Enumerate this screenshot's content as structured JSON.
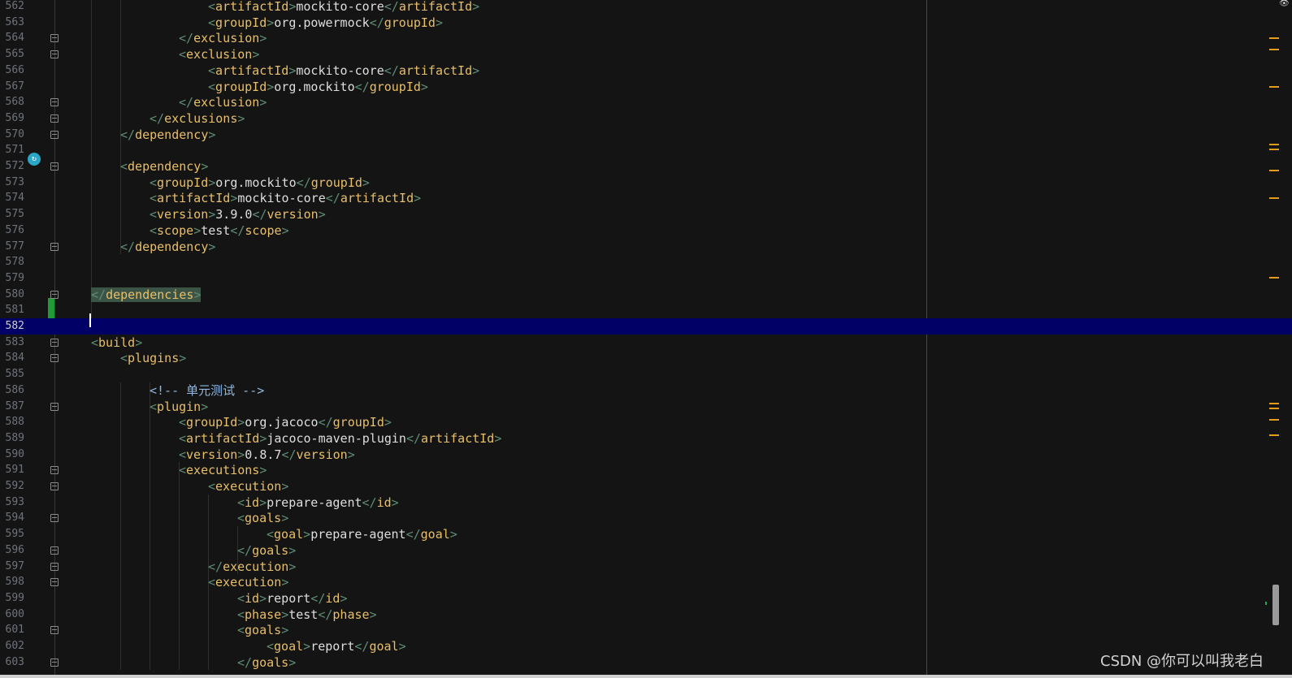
{
  "editor": {
    "lines": [
      {
        "n": "562",
        "fold": false,
        "indent": 16,
        "parts": [
          [
            "b",
            "<"
          ],
          [
            "t",
            "artifactId"
          ],
          [
            "b",
            ">"
          ],
          [
            "x",
            "mockito-core"
          ],
          [
            "b",
            "</"
          ],
          [
            "t",
            "artifactId"
          ],
          [
            "b",
            ">"
          ]
        ]
      },
      {
        "n": "563",
        "fold": false,
        "indent": 16,
        "parts": [
          [
            "b",
            "<"
          ],
          [
            "t",
            "groupId"
          ],
          [
            "b",
            ">"
          ],
          [
            "x",
            "org.powermock"
          ],
          [
            "b",
            "</"
          ],
          [
            "t",
            "groupId"
          ],
          [
            "b",
            ">"
          ]
        ]
      },
      {
        "n": "564",
        "fold": true,
        "indent": 12,
        "parts": [
          [
            "b",
            "</"
          ],
          [
            "t",
            "exclusion"
          ],
          [
            "b",
            ">"
          ]
        ]
      },
      {
        "n": "565",
        "fold": true,
        "indent": 12,
        "parts": [
          [
            "b",
            "<"
          ],
          [
            "t",
            "exclusion"
          ],
          [
            "b",
            ">"
          ]
        ]
      },
      {
        "n": "566",
        "fold": false,
        "indent": 16,
        "parts": [
          [
            "b",
            "<"
          ],
          [
            "t",
            "artifactId"
          ],
          [
            "b",
            ">"
          ],
          [
            "x",
            "mockito-core"
          ],
          [
            "b",
            "</"
          ],
          [
            "t",
            "artifactId"
          ],
          [
            "b",
            ">"
          ]
        ]
      },
      {
        "n": "567",
        "fold": false,
        "indent": 16,
        "parts": [
          [
            "b",
            "<"
          ],
          [
            "t",
            "groupId"
          ],
          [
            "b",
            ">"
          ],
          [
            "x",
            "org.mockito"
          ],
          [
            "b",
            "</"
          ],
          [
            "t",
            "groupId"
          ],
          [
            "b",
            ">"
          ]
        ]
      },
      {
        "n": "568",
        "fold": true,
        "indent": 12,
        "parts": [
          [
            "b",
            "</"
          ],
          [
            "t",
            "exclusion"
          ],
          [
            "b",
            ">"
          ]
        ]
      },
      {
        "n": "569",
        "fold": true,
        "indent": 8,
        "parts": [
          [
            "b",
            "</"
          ],
          [
            "t",
            "exclusions"
          ],
          [
            "b",
            ">"
          ]
        ]
      },
      {
        "n": "570",
        "fold": true,
        "indent": 4,
        "parts": [
          [
            "b",
            "</"
          ],
          [
            "t",
            "dependency"
          ],
          [
            "b",
            ">"
          ]
        ]
      },
      {
        "n": "571",
        "fold": false,
        "indent": 0,
        "parts": []
      },
      {
        "n": "572",
        "fold": true,
        "indent": 4,
        "parts": [
          [
            "b",
            "<"
          ],
          [
            "t",
            "dependency"
          ],
          [
            "b",
            ">"
          ]
        ]
      },
      {
        "n": "573",
        "fold": false,
        "indent": 8,
        "parts": [
          [
            "b",
            "<"
          ],
          [
            "t",
            "groupId"
          ],
          [
            "b",
            ">"
          ],
          [
            "x",
            "org.mockito"
          ],
          [
            "b",
            "</"
          ],
          [
            "t",
            "groupId"
          ],
          [
            "b",
            ">"
          ]
        ]
      },
      {
        "n": "574",
        "fold": false,
        "indent": 8,
        "parts": [
          [
            "b",
            "<"
          ],
          [
            "t",
            "artifactId"
          ],
          [
            "b",
            ">"
          ],
          [
            "x",
            "mockito-core"
          ],
          [
            "b",
            "</"
          ],
          [
            "t",
            "artifactId"
          ],
          [
            "b",
            ">"
          ]
        ]
      },
      {
        "n": "575",
        "fold": false,
        "indent": 8,
        "parts": [
          [
            "b",
            "<"
          ],
          [
            "t",
            "version"
          ],
          [
            "b",
            ">"
          ],
          [
            "x",
            "3.9.0"
          ],
          [
            "b",
            "</"
          ],
          [
            "t",
            "version"
          ],
          [
            "b",
            ">"
          ]
        ]
      },
      {
        "n": "576",
        "fold": false,
        "indent": 8,
        "parts": [
          [
            "b",
            "<"
          ],
          [
            "t",
            "scope"
          ],
          [
            "b",
            ">"
          ],
          [
            "x",
            "test"
          ],
          [
            "b",
            "</"
          ],
          [
            "t",
            "scope"
          ],
          [
            "b",
            ">"
          ]
        ]
      },
      {
        "n": "577",
        "fold": true,
        "indent": 4,
        "parts": [
          [
            "b",
            "</"
          ],
          [
            "t",
            "dependency"
          ],
          [
            "b",
            ">"
          ]
        ]
      },
      {
        "n": "578",
        "fold": false,
        "indent": 0,
        "parts": []
      },
      {
        "n": "579",
        "fold": false,
        "indent": 0,
        "parts": []
      },
      {
        "n": "580",
        "fold": true,
        "indent": 0,
        "highlight": true,
        "parts": [
          [
            "b",
            "</"
          ],
          [
            "t",
            "dependencies"
          ],
          [
            "b",
            ">"
          ]
        ]
      },
      {
        "n": "581",
        "fold": false,
        "indent": 0,
        "parts": []
      },
      {
        "n": "582",
        "fold": false,
        "indent": 0,
        "current": true,
        "parts": []
      },
      {
        "n": "583",
        "fold": true,
        "indent": 0,
        "parts": [
          [
            "b",
            "<"
          ],
          [
            "t",
            "build"
          ],
          [
            "b",
            ">"
          ]
        ]
      },
      {
        "n": "584",
        "fold": true,
        "indent": 4,
        "parts": [
          [
            "b",
            "<"
          ],
          [
            "t",
            "plugins"
          ],
          [
            "b",
            ">"
          ]
        ]
      },
      {
        "n": "585",
        "fold": false,
        "indent": 0,
        "parts": []
      },
      {
        "n": "586",
        "fold": false,
        "indent": 8,
        "parts": [
          [
            "c",
            "<!-- 单元测试 -->"
          ]
        ]
      },
      {
        "n": "587",
        "fold": true,
        "indent": 8,
        "parts": [
          [
            "b",
            "<"
          ],
          [
            "t",
            "plugin"
          ],
          [
            "b",
            ">"
          ]
        ]
      },
      {
        "n": "588",
        "fold": false,
        "indent": 12,
        "parts": [
          [
            "b",
            "<"
          ],
          [
            "t",
            "groupId"
          ],
          [
            "b",
            ">"
          ],
          [
            "x",
            "org.jacoco"
          ],
          [
            "b",
            "</"
          ],
          [
            "t",
            "groupId"
          ],
          [
            "b",
            ">"
          ]
        ]
      },
      {
        "n": "589",
        "fold": false,
        "indent": 12,
        "parts": [
          [
            "b",
            "<"
          ],
          [
            "t",
            "artifactId"
          ],
          [
            "b",
            ">"
          ],
          [
            "x",
            "jacoco-maven-plugin"
          ],
          [
            "b",
            "</"
          ],
          [
            "t",
            "artifactId"
          ],
          [
            "b",
            ">"
          ]
        ]
      },
      {
        "n": "590",
        "fold": false,
        "indent": 12,
        "parts": [
          [
            "b",
            "<"
          ],
          [
            "t",
            "version"
          ],
          [
            "b",
            ">"
          ],
          [
            "x",
            "0.8.7"
          ],
          [
            "b",
            "</"
          ],
          [
            "t",
            "version"
          ],
          [
            "b",
            ">"
          ]
        ]
      },
      {
        "n": "591",
        "fold": true,
        "indent": 12,
        "parts": [
          [
            "b",
            "<"
          ],
          [
            "t",
            "executions"
          ],
          [
            "b",
            ">"
          ]
        ]
      },
      {
        "n": "592",
        "fold": true,
        "indent": 16,
        "parts": [
          [
            "b",
            "<"
          ],
          [
            "t",
            "execution"
          ],
          [
            "b",
            ">"
          ]
        ]
      },
      {
        "n": "593",
        "fold": false,
        "indent": 20,
        "parts": [
          [
            "b",
            "<"
          ],
          [
            "t",
            "id"
          ],
          [
            "b",
            ">"
          ],
          [
            "x",
            "prepare-agent"
          ],
          [
            "b",
            "</"
          ],
          [
            "t",
            "id"
          ],
          [
            "b",
            ">"
          ]
        ]
      },
      {
        "n": "594",
        "fold": true,
        "indent": 20,
        "parts": [
          [
            "b",
            "<"
          ],
          [
            "t",
            "goals"
          ],
          [
            "b",
            ">"
          ]
        ]
      },
      {
        "n": "595",
        "fold": false,
        "indent": 24,
        "parts": [
          [
            "b",
            "<"
          ],
          [
            "t",
            "goal"
          ],
          [
            "b",
            ">"
          ],
          [
            "x",
            "prepare-agent"
          ],
          [
            "b",
            "</"
          ],
          [
            "t",
            "goal"
          ],
          [
            "b",
            ">"
          ]
        ]
      },
      {
        "n": "596",
        "fold": true,
        "indent": 20,
        "parts": [
          [
            "b",
            "</"
          ],
          [
            "t",
            "goals"
          ],
          [
            "b",
            ">"
          ]
        ]
      },
      {
        "n": "597",
        "fold": true,
        "indent": 16,
        "parts": [
          [
            "b",
            "</"
          ],
          [
            "t",
            "execution"
          ],
          [
            "b",
            ">"
          ]
        ]
      },
      {
        "n": "598",
        "fold": true,
        "indent": 16,
        "parts": [
          [
            "b",
            "<"
          ],
          [
            "t",
            "execution"
          ],
          [
            "b",
            ">"
          ]
        ]
      },
      {
        "n": "599",
        "fold": false,
        "indent": 20,
        "parts": [
          [
            "b",
            "<"
          ],
          [
            "t",
            "id"
          ],
          [
            "b",
            ">"
          ],
          [
            "x",
            "report"
          ],
          [
            "b",
            "</"
          ],
          [
            "t",
            "id"
          ],
          [
            "b",
            ">"
          ]
        ]
      },
      {
        "n": "600",
        "fold": false,
        "indent": 20,
        "parts": [
          [
            "b",
            "<"
          ],
          [
            "t",
            "phase"
          ],
          [
            "b",
            ">"
          ],
          [
            "x",
            "test"
          ],
          [
            "b",
            "</"
          ],
          [
            "t",
            "phase"
          ],
          [
            "b",
            ">"
          ]
        ]
      },
      {
        "n": "601",
        "fold": true,
        "indent": 20,
        "parts": [
          [
            "b",
            "<"
          ],
          [
            "t",
            "goals"
          ],
          [
            "b",
            ">"
          ]
        ]
      },
      {
        "n": "602",
        "fold": false,
        "indent": 24,
        "parts": [
          [
            "b",
            "<"
          ],
          [
            "t",
            "goal"
          ],
          [
            "b",
            ">"
          ],
          [
            "x",
            "report"
          ],
          [
            "b",
            "</"
          ],
          [
            "t",
            "goal"
          ],
          [
            "b",
            ">"
          ]
        ]
      },
      {
        "n": "603",
        "fold": true,
        "indent": 20,
        "parts": [
          [
            "b",
            "</"
          ],
          [
            "t",
            "goals"
          ],
          [
            "b",
            ">"
          ]
        ]
      }
    ],
    "stripes": [
      46,
      60,
      106,
      177,
      183,
      209,
      243,
      341,
      496,
      502,
      516,
      535
    ]
  },
  "colors": {
    "background": "#141414",
    "bracket": "#5f8d74",
    "tag": "#e8bf6a",
    "text": "#dedede",
    "comment": "#8fb8e0",
    "current_line": "#000066",
    "warning_stripe": "#e39b1c",
    "change_marker": "#1e9a3a"
  },
  "watermark": "CSDN @你可以叫我老白"
}
